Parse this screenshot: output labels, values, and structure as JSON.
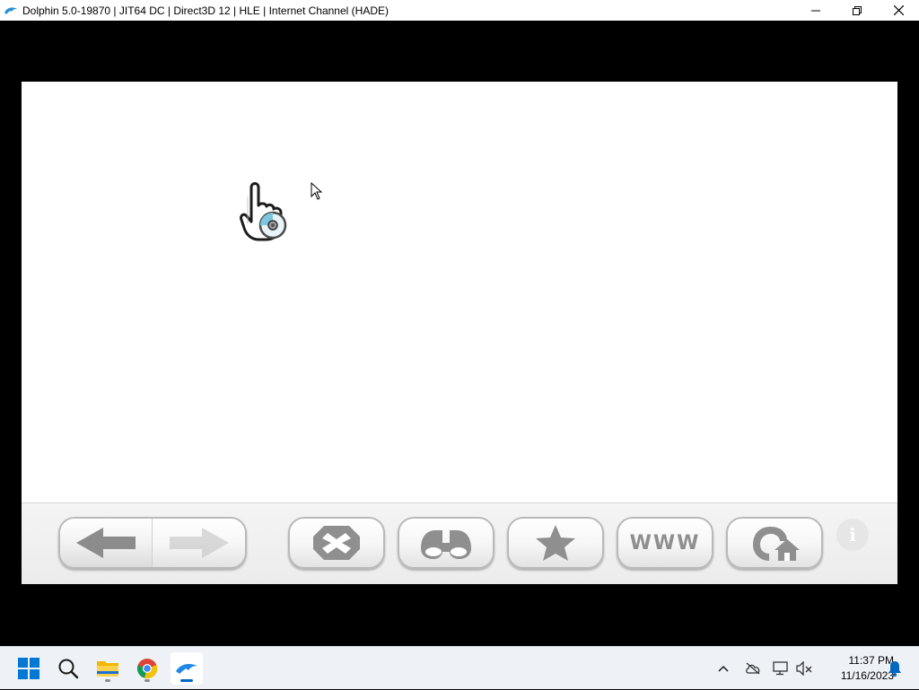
{
  "window": {
    "title": "Dolphin 5.0-19870 | JIT64 DC | Direct3D 12 | HLE | Internet Channel (HADE)",
    "icon": "dolphin-icon",
    "controls": [
      "minimize-icon",
      "restore-icon",
      "close-icon"
    ]
  },
  "toolbar": {
    "buttons": [
      {
        "name": "back",
        "icon": "arrow-left-icon"
      },
      {
        "name": "forward",
        "icon": "arrow-right-icon",
        "enabled": false
      },
      {
        "name": "stop",
        "icon": "stop-x-icon"
      },
      {
        "name": "search",
        "icon": "binoculars-icon"
      },
      {
        "name": "favorites",
        "icon": "star-icon"
      },
      {
        "name": "www",
        "label": "WWW"
      },
      {
        "name": "home",
        "icon": "home-page-icon"
      },
      {
        "name": "info",
        "label": "i"
      }
    ]
  },
  "pointer": {
    "icon": "wii-hand-pointer-icon"
  },
  "taskbar": {
    "apps": [
      "windows-start-icon",
      "search-icon",
      "file-explorer-icon",
      "chrome-icon",
      "dolphin-icon"
    ],
    "active_app": "dolphin-icon",
    "tray": [
      "chevron-up-icon",
      "onedrive-offline-icon",
      "display-icon",
      "speaker-muted-icon",
      "notification-bell-icon"
    ],
    "time": "11:37 PM",
    "date": "11/16/2023"
  },
  "colors": {
    "titlebar": "#ffffff",
    "screen_bg": "#ffffff",
    "toolbar_bg": "#efefef",
    "taskbar_bg": "#eef1f6",
    "accent": "#0067c0"
  }
}
